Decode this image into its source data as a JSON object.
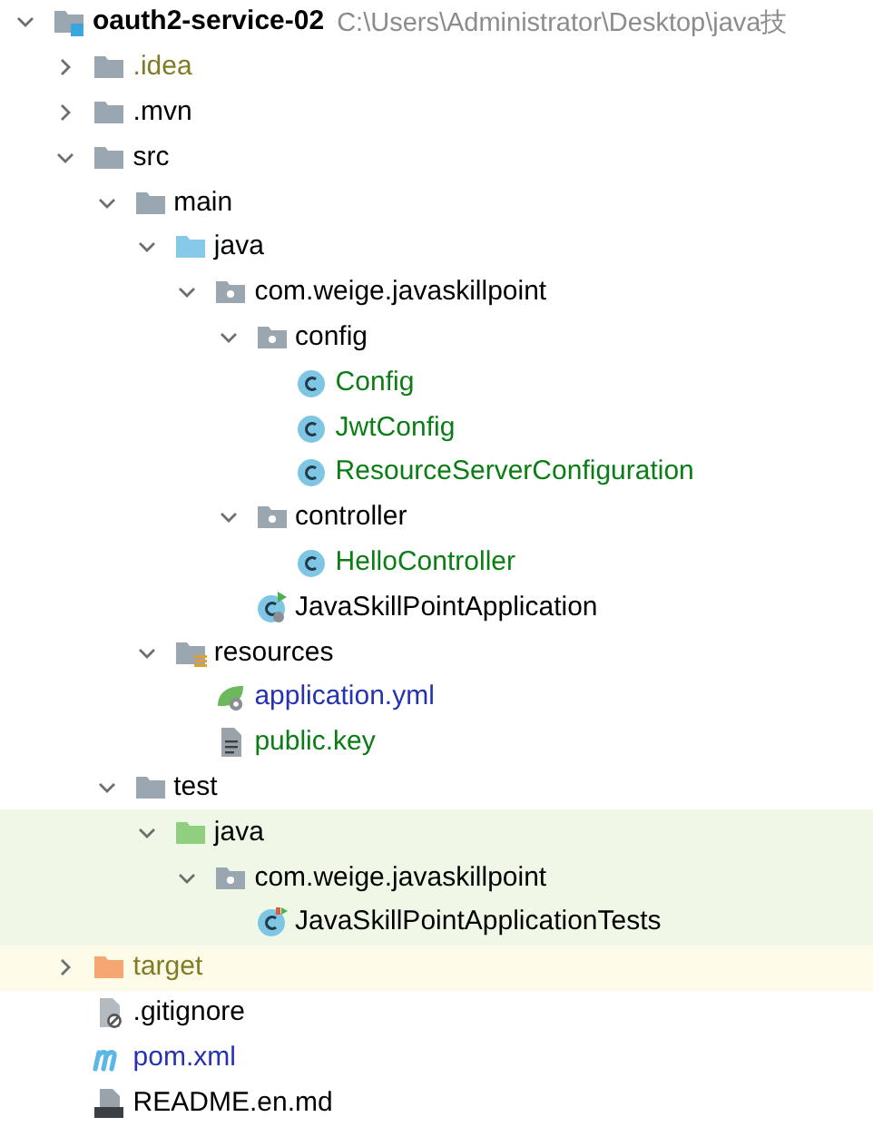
{
  "project_tree": {
    "root": {
      "name": "oauth2-service-02",
      "path": "C:\\Users\\Administrator\\Desktop\\java技",
      "kind": "module",
      "expanded": true,
      "color": "#000000",
      "children": [
        {
          "name": ".idea",
          "kind": "folder",
          "expanded": false,
          "color": "#827b26"
        },
        {
          "name": ".mvn",
          "kind": "folder",
          "expanded": false,
          "color": "#000000"
        },
        {
          "name": "src",
          "kind": "folder",
          "expanded": true,
          "color": "#000000",
          "children": [
            {
              "name": "main",
              "kind": "folder",
              "expanded": true,
              "color": "#000000",
              "children": [
                {
                  "name": "java",
                  "kind": "source",
                  "expanded": true,
                  "color": "#000000",
                  "children": [
                    {
                      "name": "com.weige.javaskillpoint",
                      "kind": "package",
                      "expanded": true,
                      "color": "#000000",
                      "children": [
                        {
                          "name": "config",
                          "kind": "package",
                          "expanded": true,
                          "color": "#000000",
                          "children": [
                            {
                              "name": "Config",
                              "kind": "class",
                              "color": "#0a7d14"
                            },
                            {
                              "name": "JwtConfig",
                              "kind": "class",
                              "color": "#0a7d14"
                            },
                            {
                              "name": "ResourceServerConfiguration",
                              "kind": "class",
                              "color": "#0a7d14"
                            }
                          ]
                        },
                        {
                          "name": "controller",
                          "kind": "package",
                          "expanded": true,
                          "color": "#000000",
                          "children": [
                            {
                              "name": "HelloController",
                              "kind": "class",
                              "color": "#0a7d14"
                            }
                          ]
                        },
                        {
                          "name": "JavaSkillPointApplication",
                          "kind": "application",
                          "color": "#000000"
                        }
                      ]
                    }
                  ]
                },
                {
                  "name": "resources",
                  "kind": "resources",
                  "expanded": true,
                  "color": "#000000",
                  "children": [
                    {
                      "name": "application.yml",
                      "kind": "config",
                      "color": "#2632b0"
                    },
                    {
                      "name": "public.key",
                      "kind": "text",
                      "color": "#0a7d14"
                    }
                  ]
                }
              ]
            },
            {
              "name": "test",
              "kind": "folder",
              "expanded": true,
              "color": "#000000",
              "children": [
                {
                  "name": "java",
                  "kind": "tests",
                  "expanded": true,
                  "color": "#000000",
                  "test_scope": true,
                  "children": [
                    {
                      "name": "com.weige.javaskillpoint",
                      "kind": "package",
                      "expanded": true,
                      "color": "#000000",
                      "test_scope": true,
                      "children": [
                        {
                          "name": "JavaSkillPointApplicationTests",
                          "kind": "test",
                          "color": "#000000",
                          "test_scope": true
                        }
                      ]
                    }
                  ]
                }
              ]
            }
          ]
        },
        {
          "name": "target",
          "kind": "excluded",
          "expanded": false,
          "color": "#827b26",
          "excluded": true
        },
        {
          "name": ".gitignore",
          "kind": "ignore",
          "color": "#000000"
        },
        {
          "name": "pom.xml",
          "kind": "maven",
          "color": "#2632b0"
        },
        {
          "name": "README.en.md",
          "kind": "markdown",
          "color": "#000000"
        }
      ]
    }
  }
}
